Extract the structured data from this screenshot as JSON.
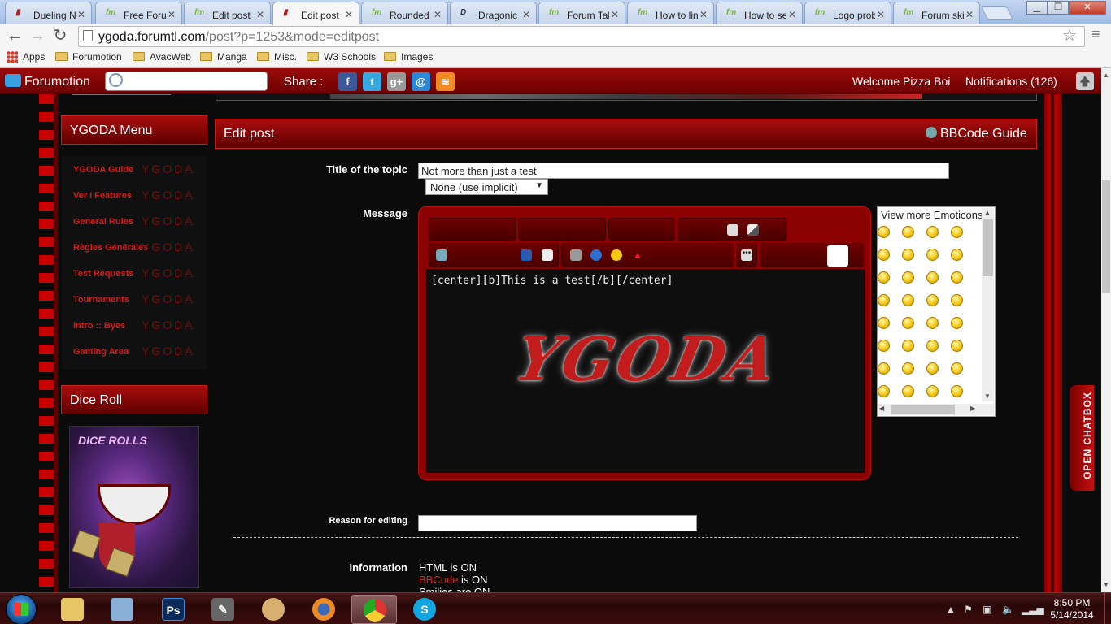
{
  "browser": {
    "tabs": [
      {
        "title": "Dueling N",
        "active": false
      },
      {
        "title": "Free Forur",
        "active": false
      },
      {
        "title": "Edit post",
        "active": false
      },
      {
        "title": "Edit post",
        "active": true
      },
      {
        "title": "Rounded (",
        "active": false
      },
      {
        "title": "Dragonic [",
        "active": false
      },
      {
        "title": "Forum Tal",
        "active": false
      },
      {
        "title": "How to lin",
        "active": false
      },
      {
        "title": "How to se",
        "active": false
      },
      {
        "title": "Logo prob",
        "active": false
      },
      {
        "title": "Forum ski",
        "active": false
      }
    ],
    "url_host": "ygoda.forumtl.com",
    "url_path": "/post?p=1253&mode=editpost",
    "bookmarks": [
      "Apps",
      "Forumotion",
      "AvacWeb",
      "Manga",
      "Misc.",
      "W3 Schools",
      "Images"
    ]
  },
  "fmbar": {
    "brand": "Forumotion",
    "share_label": "Share :",
    "welcome": "Welcome Pizza Boi",
    "notifications": "Notifications  (126)"
  },
  "sidebar": {
    "menu_title": "YGODA Menu",
    "items": [
      {
        "label": "YGODA Guide"
      },
      {
        "label": "Ver I Features"
      },
      {
        "label": "General Rules"
      },
      {
        "label": "Règles Générales"
      },
      {
        "label": "Test Requests"
      },
      {
        "label": "Tournaments"
      },
      {
        "label": "Intro :: Byes"
      },
      {
        "label": "Gaming Area"
      }
    ],
    "watermark": "YGODA",
    "dice_title": "Dice Roll",
    "dice_image_text": "DICE ROLLS"
  },
  "editpost": {
    "header": "Edit post",
    "bbcode_guide": "BBCode Guide",
    "title_label": "Title of the topic",
    "title_value": "Not more than just a test",
    "icon_select": "None (use implicit)",
    "message_label": "Message",
    "message_value": "[center][b]This is a test[/b][/center]",
    "editor_logo": "YGODA",
    "emoticons_header": "View more Emoticons",
    "reason_label": "Reason for editing",
    "reason_value": "",
    "info_label": "Information",
    "info_html": "HTML is ON",
    "info_bbcode_link": "BBCode",
    "info_bbcode_rest": " is ON",
    "info_smilies": "Smilies are ON"
  },
  "chatbox_label": "OPEN CHATBOX",
  "taskbar": {
    "time": "8:50 PM",
    "date": "5/14/2014"
  }
}
